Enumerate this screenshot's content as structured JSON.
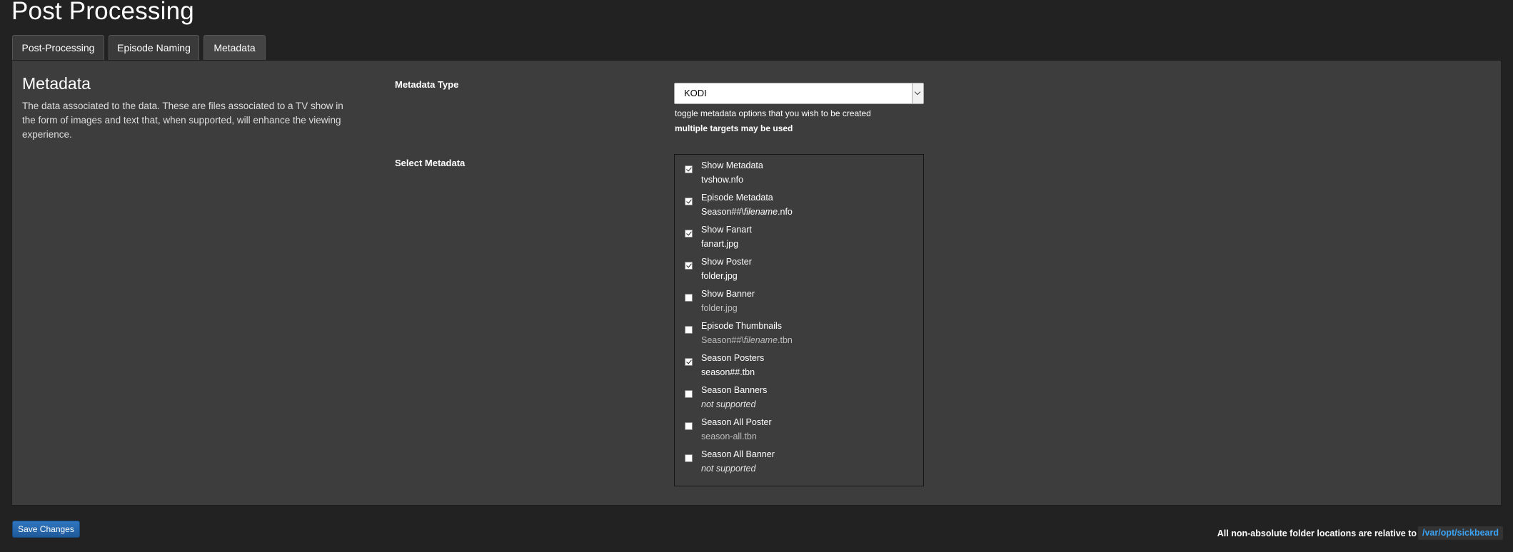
{
  "page": {
    "title": "Post Processing"
  },
  "tabs": [
    {
      "label": "Post-Processing",
      "active": false
    },
    {
      "label": "Episode Naming",
      "active": false
    },
    {
      "label": "Metadata",
      "active": true
    }
  ],
  "metadata_section": {
    "title": "Metadata",
    "description": "The data associated to the data. These are files associated to a TV show in the form of images and text that, when supported, will enhance the viewing experience."
  },
  "metadata_type": {
    "label": "Metadata Type",
    "selected": "KODI",
    "help": "toggle metadata options that you wish to be created",
    "help_bold": "multiple targets may be used"
  },
  "select_metadata": {
    "label": "Select Metadata",
    "items": [
      {
        "name": "Show Metadata",
        "file": "tvshow.nfo",
        "checked": true,
        "style": "normal"
      },
      {
        "name": "Episode Metadata",
        "file_prefix": "Season##\\",
        "file_italic": "filename",
        "file_suffix": ".nfo",
        "checked": true,
        "style": "normal"
      },
      {
        "name": "Show Fanart",
        "file": "fanart.jpg",
        "checked": true,
        "style": "normal"
      },
      {
        "name": "Show Poster",
        "file": "folder.jpg",
        "checked": true,
        "style": "normal"
      },
      {
        "name": "Show Banner",
        "file": "folder.jpg",
        "checked": false,
        "style": "dim"
      },
      {
        "name": "Episode Thumbnails",
        "file_prefix": "Season##\\",
        "file_italic": "filename",
        "file_suffix": ".tbn",
        "checked": false,
        "style": "dim"
      },
      {
        "name": "Season Posters",
        "file": "season##.tbn",
        "checked": true,
        "style": "normal"
      },
      {
        "name": "Season Banners",
        "file": "not supported",
        "checked": false,
        "style": "unsupported"
      },
      {
        "name": "Season All Poster",
        "file": "season-all.tbn",
        "checked": false,
        "style": "dim"
      },
      {
        "name": "Season All Banner",
        "file": "not supported",
        "checked": false,
        "style": "unsupported"
      }
    ]
  },
  "actions": {
    "save_label": "Save Changes"
  },
  "footer": {
    "note": "All non-absolute folder locations are relative to",
    "path": "/var/opt/sickbeard"
  }
}
